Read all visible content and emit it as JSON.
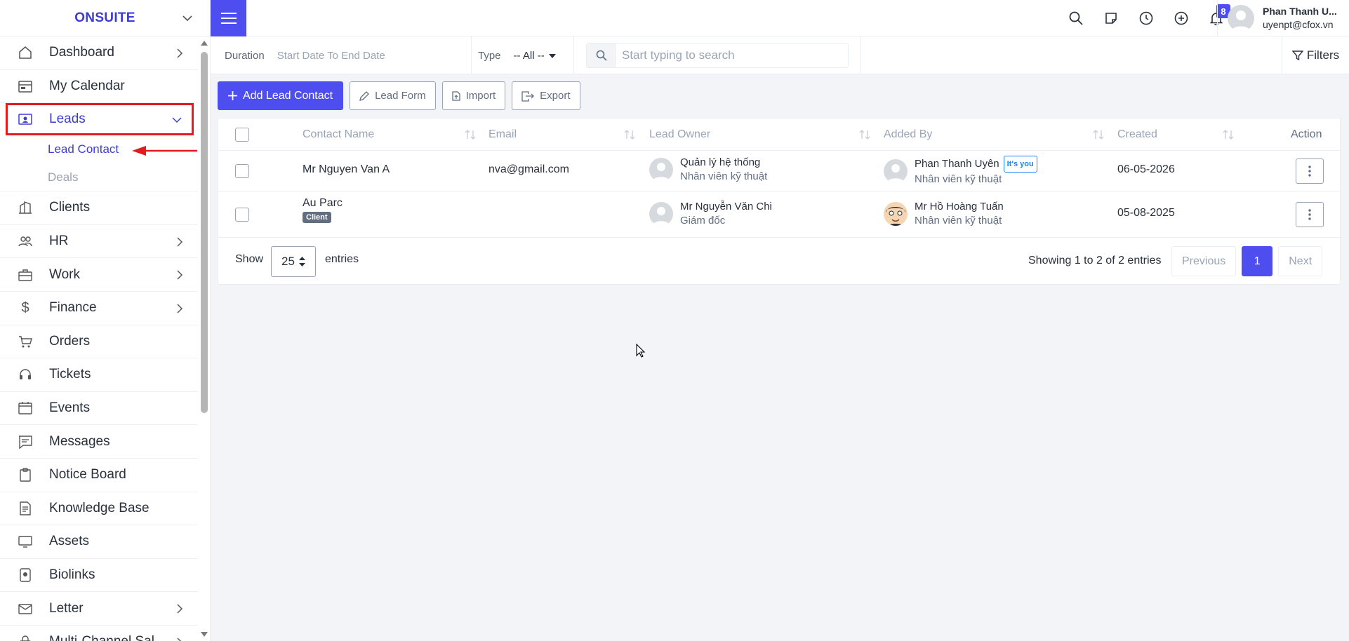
{
  "sidebar": {
    "brand": "ONSUITE",
    "items": [
      {
        "label": "Dashboard",
        "icon": "home-icon",
        "has_arrow": true
      },
      {
        "label": "My Calendar",
        "icon": "calendar-icon",
        "has_arrow": false
      },
      {
        "label": "Leads",
        "icon": "contact-card-icon",
        "expanded": true
      },
      {
        "label": "Clients",
        "icon": "building-icon",
        "has_arrow": false
      },
      {
        "label": "HR",
        "icon": "users-icon",
        "has_arrow": true
      },
      {
        "label": "Work",
        "icon": "briefcase-icon",
        "has_arrow": true
      },
      {
        "label": "Finance",
        "icon": "dollar-icon",
        "has_arrow": true
      },
      {
        "label": "Orders",
        "icon": "cart-icon",
        "has_arrow": false
      },
      {
        "label": "Tickets",
        "icon": "headset-icon",
        "has_arrow": false
      },
      {
        "label": "Events",
        "icon": "event-icon",
        "has_arrow": false
      },
      {
        "label": "Messages",
        "icon": "message-icon",
        "has_arrow": false
      },
      {
        "label": "Notice Board",
        "icon": "clipboard-icon",
        "has_arrow": false
      },
      {
        "label": "Knowledge Base",
        "icon": "document-icon",
        "has_arrow": false
      },
      {
        "label": "Assets",
        "icon": "monitor-icon",
        "has_arrow": false
      },
      {
        "label": "Biolinks",
        "icon": "id-badge-icon",
        "has_arrow": false
      },
      {
        "label": "Letter",
        "icon": "mail-icon",
        "has_arrow": true
      },
      {
        "label": "Multi-Channel Sal...",
        "icon": "lock-icon",
        "has_arrow": true
      }
    ],
    "leads_sub": [
      "Lead Contact",
      "Deals"
    ]
  },
  "header": {
    "notification_count": "8",
    "user_name": "Phan Thanh U...",
    "user_email": "uyenpt@cfox.vn"
  },
  "filterbar": {
    "duration_label": "Duration",
    "duration_value": "Start Date To End Date",
    "type_label": "Type",
    "type_value": "-- All --",
    "search_placeholder": "Start typing to search",
    "filters_label": "Filters"
  },
  "actions": {
    "add": "Add Lead Contact",
    "form": "Lead Form",
    "import": "Import",
    "export": "Export"
  },
  "table": {
    "columns": [
      "Contact Name",
      "Email",
      "Lead Owner",
      "Added By",
      "Created",
      "Action"
    ],
    "rows": [
      {
        "name": "Mr Nguyen Van A",
        "tag": "",
        "email": "nva@gmail.com",
        "owner_name": "Quản lý hệ thống",
        "owner_role": "Nhân viên kỹ thuật",
        "added_name": "Phan Thanh Uyên",
        "added_badge": "It's you",
        "added_role": "Nhân viên kỹ thuật",
        "created": "06-05-2026"
      },
      {
        "name": "Au Parc",
        "tag": "Client",
        "email": "",
        "owner_name": "Mr Nguyễn Văn Chi",
        "owner_role": "Giám đốc",
        "added_name": "Mr Hồ Hoàng Tuấn",
        "added_badge": "",
        "added_role": "Nhân viên kỹ thuật",
        "created": "05-08-2025"
      }
    ],
    "show_label": "Show",
    "page_size": "25",
    "entries_label": "entries",
    "showing_text": "Showing 1 to 2 of 2 entries",
    "prev": "Previous",
    "page": "1",
    "next": "Next"
  },
  "colors": {
    "accent": "#4d4df0",
    "highlight_red": "#e21c1c"
  }
}
